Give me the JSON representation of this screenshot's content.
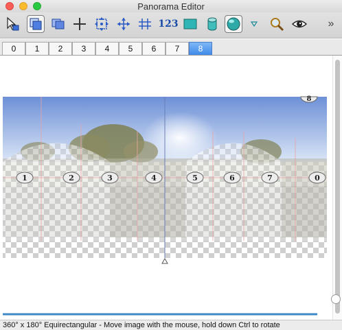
{
  "window": {
    "title": "Panorama Editor"
  },
  "toolbar": {
    "tools": [
      {
        "name": "select-arrow-icon"
      },
      {
        "name": "image-layer-icon",
        "active": true
      },
      {
        "name": "overlay-layers-icon"
      },
      {
        "name": "crosshair-icon"
      },
      {
        "name": "move-arrows-icon"
      },
      {
        "name": "center-move-icon"
      },
      {
        "name": "align-icon"
      },
      {
        "name": "numbers-tool",
        "label": "123"
      },
      {
        "name": "rectangle-icon"
      },
      {
        "name": "cylinder-icon"
      },
      {
        "name": "sphere-icon"
      },
      {
        "name": "dropdown-triangle-icon"
      },
      {
        "name": "magnifier-icon"
      },
      {
        "name": "eye-icon"
      },
      {
        "name": "overflow-chevrons-icon",
        "label": "»"
      }
    ]
  },
  "tabs": [
    "0",
    "1",
    "2",
    "3",
    "4",
    "5",
    "6",
    "7",
    "8"
  ],
  "active_tab": "8",
  "panorama": {
    "markers": [
      "1",
      "2",
      "3",
      "4",
      "5",
      "6",
      "7",
      "0"
    ],
    "top_marker": "8"
  },
  "status": {
    "text": "360° x 180° Equirectangular - Move image with the mouse, hold down Ctrl to rotate"
  },
  "colors": {
    "sky_top": "#6d90d6",
    "sky_bottom": "#dbe6f7",
    "tab_active": "#3f8ae8",
    "progress": "#3d88c6",
    "guide_line": "#e9a4a4"
  }
}
